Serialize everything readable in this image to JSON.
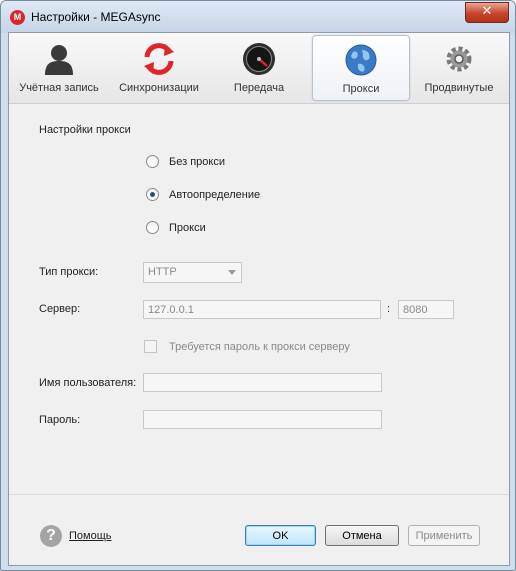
{
  "window": {
    "title": "Настройки - MEGAsync",
    "app_icon_letter": "M",
    "close_glyph": "✕"
  },
  "tabs": [
    {
      "label": "Учётная запись",
      "icon": "user-icon"
    },
    {
      "label": "Синхронизации",
      "icon": "sync-icon"
    },
    {
      "label": "Передача",
      "icon": "speedometer-icon"
    },
    {
      "label": "Прокси",
      "icon": "globe-icon",
      "active": true
    },
    {
      "label": "Продвинутые",
      "icon": "gear-icon"
    }
  ],
  "proxy": {
    "section_title": "Настройки прокси",
    "options": [
      {
        "label": "Без прокси",
        "checked": false
      },
      {
        "label": "Автоопределение",
        "checked": true
      },
      {
        "label": "Прокси",
        "checked": false
      }
    ],
    "type_label": "Тип прокси:",
    "type_value": "HTTP",
    "server_label": "Сервер:",
    "server_value": "127.0.0.1",
    "port_separator": ":",
    "port_value": "8080",
    "auth_label": "Требуется пароль к прокси серверу",
    "auth_checked": false,
    "username_label": "Имя пользователя:",
    "username_value": "",
    "password_label": "Пароль:",
    "password_value": ""
  },
  "footer": {
    "help_glyph": "?",
    "help_label": "Помощь",
    "ok_label": "OK",
    "cancel_label": "Отмена",
    "apply_label": "Применить"
  },
  "colors": {
    "accent": "#3c7fb1",
    "close_button": "#c7452c",
    "sync_red": "#e0242b",
    "globe_blue": "#3a7bc8"
  }
}
